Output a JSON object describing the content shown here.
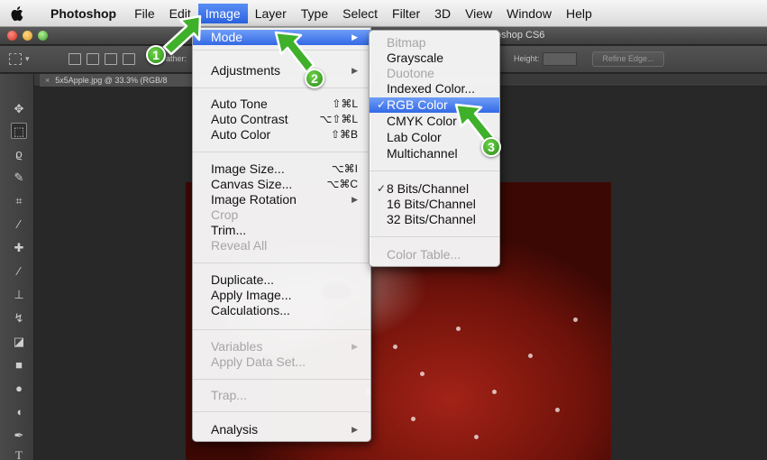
{
  "menubar": {
    "app": "Photoshop",
    "items": [
      "File",
      "Edit",
      "Image",
      "Layer",
      "Type",
      "Select",
      "Filter",
      "3D",
      "View",
      "Window",
      "Help"
    ],
    "active": "Image"
  },
  "window": {
    "title_fragment": "oshop CS6"
  },
  "options": {
    "feather_fragment": "ather:",
    "height_label": "Height:",
    "refine_edge": "Refine Edge..."
  },
  "document_tab": {
    "close": "×",
    "name": "5x5Apple.jpg @ 33.3% (RGB/8"
  },
  "image_menu": {
    "mode": "Mode",
    "adjustments": "Adjustments",
    "auto_tone": "Auto Tone",
    "auto_tone_sc": "⇧⌘L",
    "auto_contrast": "Auto Contrast",
    "auto_contrast_sc": "⌥⇧⌘L",
    "auto_color": "Auto Color",
    "auto_color_sc": "⇧⌘B",
    "image_size": "Image Size...",
    "image_size_sc": "⌥⌘I",
    "canvas_size": "Canvas Size...",
    "canvas_size_sc": "⌥⌘C",
    "image_rotation": "Image Rotation",
    "crop": "Crop",
    "trim": "Trim...",
    "reveal_all": "Reveal All",
    "duplicate": "Duplicate...",
    "apply_image": "Apply Image...",
    "calculations": "Calculations...",
    "variables": "Variables",
    "apply_data_set": "Apply Data Set...",
    "trap": "Trap...",
    "analysis": "Analysis"
  },
  "mode_menu": {
    "bitmap": "Bitmap",
    "grayscale": "Grayscale",
    "duotone": "Duotone",
    "indexed": "Indexed Color...",
    "rgb": "RGB Color",
    "cmyk": "CMYK Color",
    "lab": "Lab Color",
    "multichannel": "Multichannel",
    "bits8": "8 Bits/Channel",
    "bits16": "16 Bits/Channel",
    "bits32": "32 Bits/Channel",
    "color_table": "Color Table...",
    "check": "✓"
  },
  "callouts": [
    "1",
    "2",
    "3"
  ],
  "colors": {
    "highlight": "#3469e6",
    "callout_green": "#2b8a1a"
  }
}
